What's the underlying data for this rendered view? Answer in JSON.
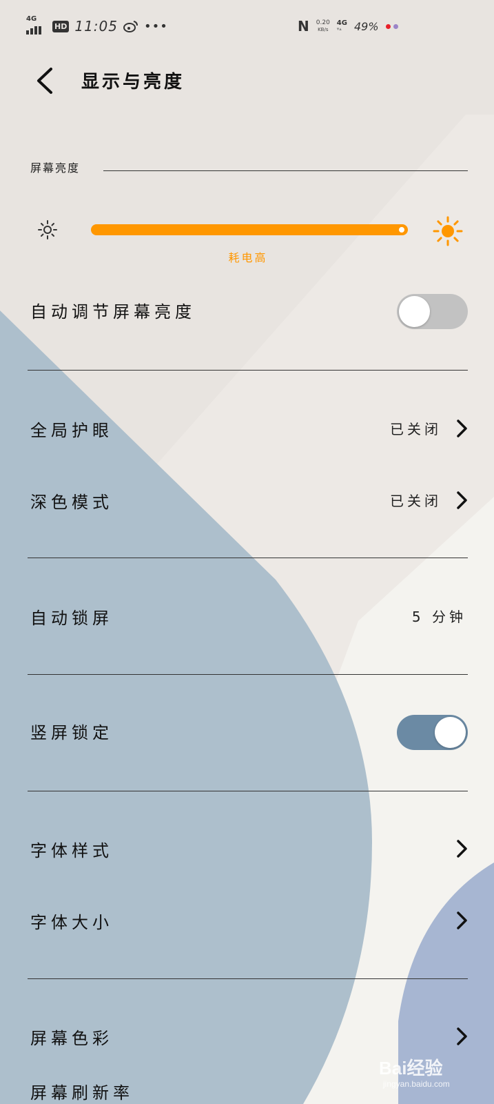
{
  "status_bar": {
    "network_type": "4G",
    "hd_badge": "HD",
    "time": "11:05",
    "more_dots": "•••",
    "speed_value": "0.20",
    "speed_unit": "KB/s",
    "cell_network": "4G",
    "battery_percent": "49%",
    "dot_colors": [
      "#e8202a",
      "#9b84c8"
    ]
  },
  "header": {
    "title": "显示与亮度",
    "back_icon": "chevron-left-icon"
  },
  "brightness_section": {
    "header": "屏幕亮度",
    "slider_level": 1.0,
    "slider_color": "#ff9700",
    "hint": "耗电高",
    "icon_min": "sun-small-icon",
    "icon_max": "sun-large-icon"
  },
  "rows": {
    "auto_brightness": {
      "label": "自动调节屏幕亮度",
      "toggle_on": false
    },
    "eye_comfort": {
      "label": "全局护眼",
      "value": "已关闭"
    },
    "dark_mode": {
      "label": "深色模式",
      "value": "已关闭"
    },
    "auto_lock": {
      "label": "自动锁屏",
      "value": "5 分钟"
    },
    "rotation_lock": {
      "label": "竖屏锁定",
      "toggle_on": true
    },
    "font_style": {
      "label": "字体样式"
    },
    "font_size": {
      "label": "字体大小"
    },
    "screen_color": {
      "label": "屏幕色彩"
    },
    "refresh_rate": {
      "label": "屏幕刷新率"
    }
  },
  "watermark": {
    "brand": "Bai经验",
    "url": "jingyan.baidu.com"
  },
  "colors": {
    "accent_orange": "#ff9700",
    "toggle_on": "#6b8aa4",
    "toggle_off": "#c2c2c2"
  }
}
